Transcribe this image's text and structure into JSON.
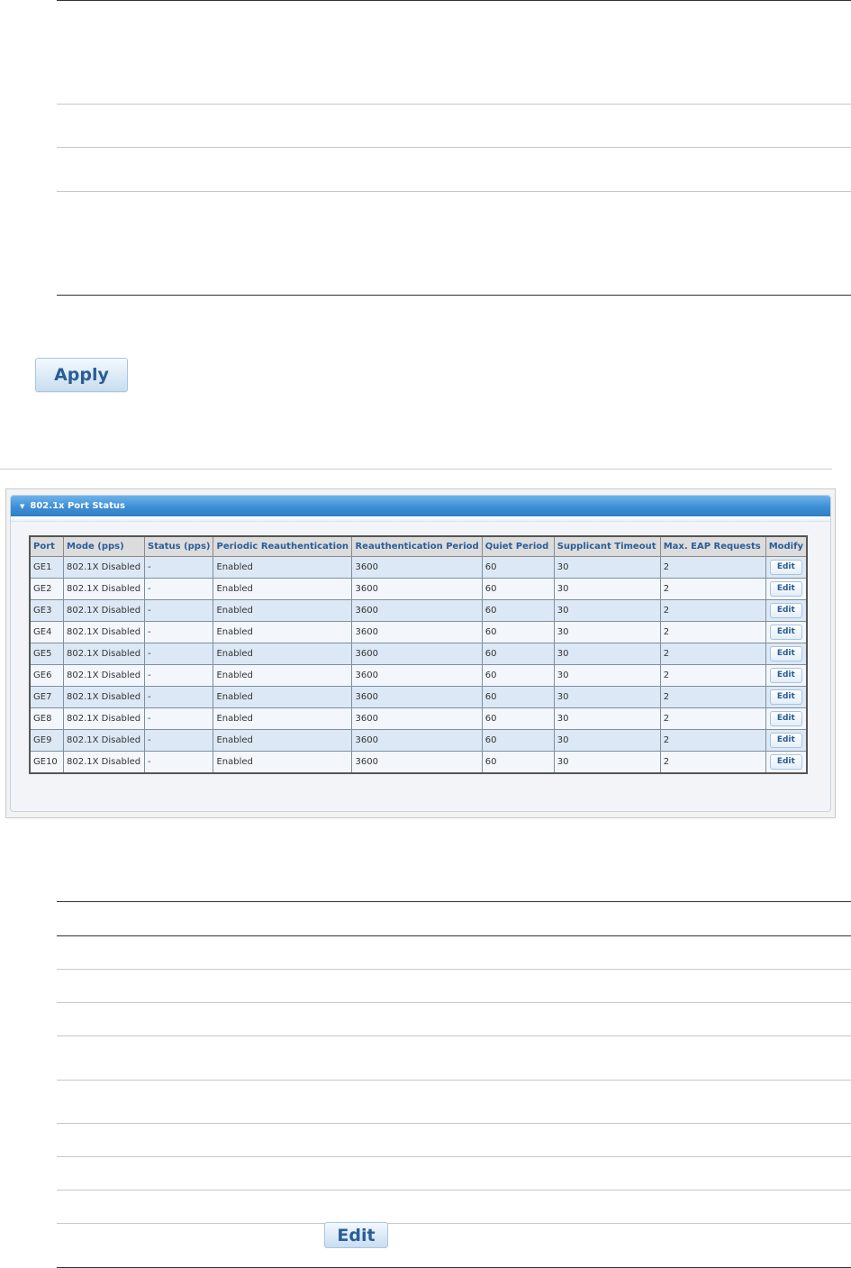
{
  "apply_button": {
    "label": "Apply"
  },
  "panel": {
    "title": "802.1x Port Status"
  },
  "table": {
    "headers": [
      "Port",
      "Mode (pps)",
      "Status (pps)",
      "Periodic Reauthentication",
      "Reauthentication Period",
      "Quiet Period",
      "Supplicant Timeout",
      "Max. EAP Requests",
      "Modify"
    ],
    "edit_label": "Edit",
    "rows": [
      {
        "port": "GE1",
        "mode": "802.1X Disabled",
        "status": "-",
        "periodic": "Enabled",
        "reauth_period": "3600",
        "quiet": "60",
        "supplicant": "30",
        "max_eap": "2"
      },
      {
        "port": "GE2",
        "mode": "802.1X Disabled",
        "status": "-",
        "periodic": "Enabled",
        "reauth_period": "3600",
        "quiet": "60",
        "supplicant": "30",
        "max_eap": "2"
      },
      {
        "port": "GE3",
        "mode": "802.1X Disabled",
        "status": "-",
        "periodic": "Enabled",
        "reauth_period": "3600",
        "quiet": "60",
        "supplicant": "30",
        "max_eap": "2"
      },
      {
        "port": "GE4",
        "mode": "802.1X Disabled",
        "status": "-",
        "periodic": "Enabled",
        "reauth_period": "3600",
        "quiet": "60",
        "supplicant": "30",
        "max_eap": "2"
      },
      {
        "port": "GE5",
        "mode": "802.1X Disabled",
        "status": "-",
        "periodic": "Enabled",
        "reauth_period": "3600",
        "quiet": "60",
        "supplicant": "30",
        "max_eap": "2"
      },
      {
        "port": "GE6",
        "mode": "802.1X Disabled",
        "status": "-",
        "periodic": "Enabled",
        "reauth_period": "3600",
        "quiet": "60",
        "supplicant": "30",
        "max_eap": "2"
      },
      {
        "port": "GE7",
        "mode": "802.1X Disabled",
        "status": "-",
        "periodic": "Enabled",
        "reauth_period": "3600",
        "quiet": "60",
        "supplicant": "30",
        "max_eap": "2"
      },
      {
        "port": "GE8",
        "mode": "802.1X Disabled",
        "status": "-",
        "periodic": "Enabled",
        "reauth_period": "3600",
        "quiet": "60",
        "supplicant": "30",
        "max_eap": "2"
      },
      {
        "port": "GE9",
        "mode": "802.1X Disabled",
        "status": "-",
        "periodic": "Enabled",
        "reauth_period": "3600",
        "quiet": "60",
        "supplicant": "30",
        "max_eap": "2"
      },
      {
        "port": "GE10",
        "mode": "802.1X Disabled",
        "status": "-",
        "periodic": "Enabled",
        "reauth_period": "3600",
        "quiet": "60",
        "supplicant": "30",
        "max_eap": "2"
      }
    ]
  },
  "edit_button_large": {
    "label": "Edit"
  },
  "colors": {
    "accent": "#2a5d97",
    "header_blue": "#3d8fd6",
    "row_odd": "#dce8f5",
    "row_even": "#f3f7fc"
  }
}
